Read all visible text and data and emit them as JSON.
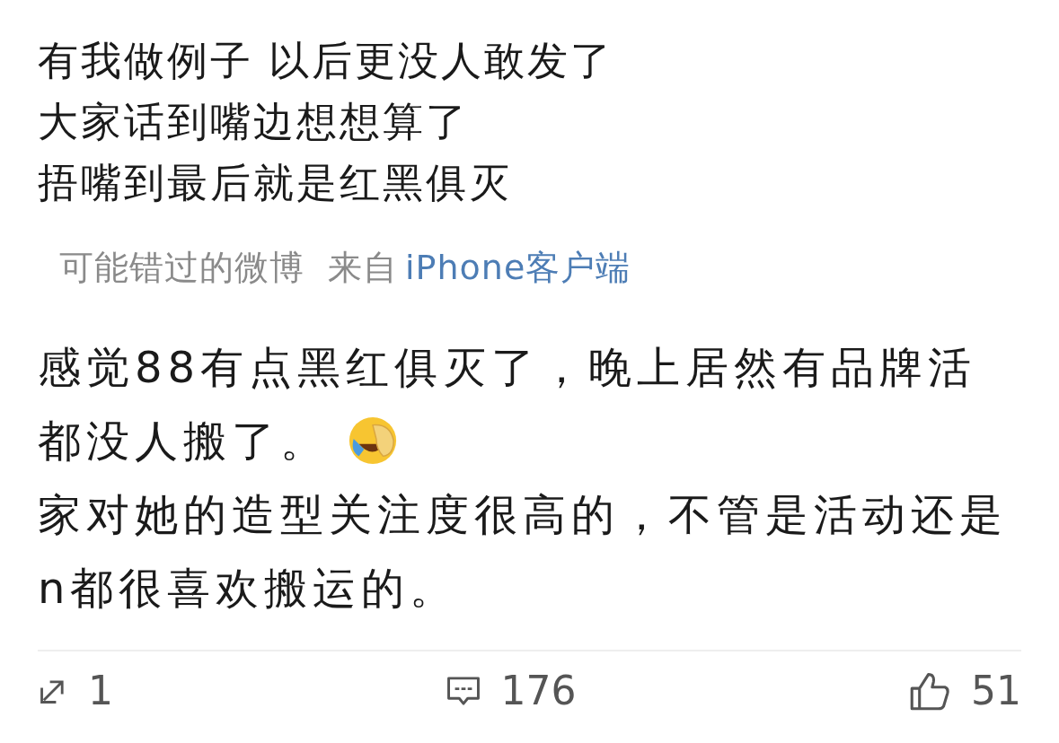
{
  "post": {
    "lines": [
      "有我做例子 以后更没人敢发了",
      "大家话到嘴边想想算了",
      "捂嘴到最后就是红黑俱灭"
    ]
  },
  "source": {
    "label": "可能错过的微博",
    "from": "来自",
    "client": "iPhone客户端"
  },
  "repost": {
    "lines": [
      {
        "text": "感觉88有点黑红俱灭了，晚上居然有品牌活",
        "emoji": false
      },
      {
        "text": "都没人搬了。",
        "emoji": true
      },
      {
        "text": "家对她的造型关注度很高的，不管是活动还是",
        "emoji": false
      },
      {
        "text": "n都很喜欢搬运的。",
        "emoji": false
      }
    ]
  },
  "actions": [
    {
      "kind": "repost",
      "count": "1"
    },
    {
      "kind": "comment",
      "count": "176"
    },
    {
      "kind": "like",
      "count": "51"
    }
  ]
}
